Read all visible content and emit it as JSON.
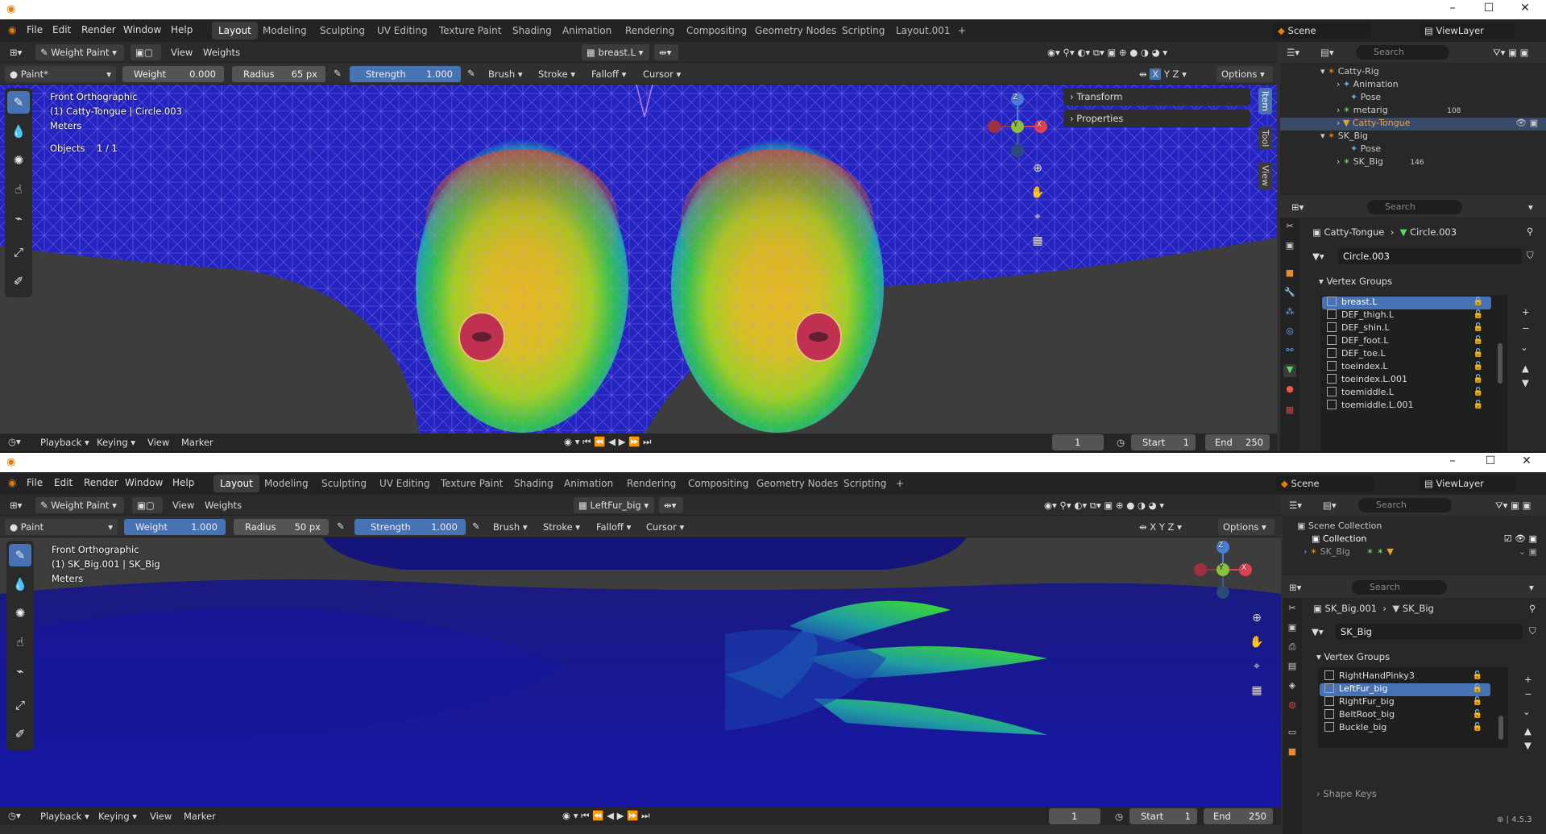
{
  "top": {
    "title_icon": "blender-logo",
    "menu": [
      "File",
      "Edit",
      "Render",
      "Window",
      "Help"
    ],
    "workspaces": [
      "Layout",
      "Modeling",
      "Sculpting",
      "UV Editing",
      "Texture Paint",
      "Shading",
      "Animation",
      "Rendering",
      "Compositing",
      "Geometry Nodes",
      "Scripting",
      "Layout.001"
    ],
    "active_workspace": "Layout",
    "add_tab": "+",
    "scene": "Scene",
    "view_layer": "ViewLayer",
    "header": {
      "mode": "Weight Paint",
      "view": "View",
      "weights": "Weights",
      "active_group": "breast.L",
      "brush_name": "Paint*",
      "weight_label": "Weight",
      "weight_value": "0.000",
      "radius_label": "Radius",
      "radius_value": "65 px",
      "strength_label": "Strength",
      "strength_value": "1.000",
      "brush": "Brush",
      "stroke": "Stroke",
      "falloff": "Falloff",
      "cursor": "Cursor",
      "options": "Options",
      "x": "X",
      "y": "Y",
      "z": "Z"
    },
    "overlay": {
      "view_name": "Front Orthographic",
      "object_info": "(1) Catty-Tongue | Circle.003",
      "units": "Meters",
      "objects_label": "Objects",
      "objects_value": "1 / 1"
    },
    "npanel": {
      "transform": "Transform",
      "properties": "Properties",
      "tabs": [
        "Item",
        "Tool",
        "View"
      ]
    },
    "gizmo": {
      "x": "X",
      "y": "Y",
      "z": "Z"
    },
    "timeline": {
      "playback": "Playback",
      "keying": "Keying",
      "view": "View",
      "marker": "Marker",
      "frame": "1",
      "start_label": "Start",
      "start": "1",
      "end_label": "End",
      "end": "250"
    },
    "outliner": {
      "search": "Search",
      "rows": [
        {
          "label": "Catty-Rig",
          "count": ""
        },
        {
          "label": "Animation",
          "count": ""
        },
        {
          "label": "Pose",
          "count": ""
        },
        {
          "label": "metarig",
          "count": "108"
        },
        {
          "label": "Catty-Tongue",
          "count": ""
        },
        {
          "label": "SK_Big",
          "count": ""
        },
        {
          "label": "Pose",
          "count": ""
        },
        {
          "label": "SK_Big",
          "count": "146"
        }
      ]
    },
    "props": {
      "search": "Search",
      "breadcrumb_obj": "Catty-Tongue",
      "breadcrumb_data": "Circle.003",
      "data_name": "Circle.003",
      "vg_title": "Vertex Groups",
      "groups": [
        "breast.L",
        "DEF_thigh.L",
        "DEF_shin.L",
        "DEF_foot.L",
        "DEF_toe.L",
        "toeindex.L",
        "toeindex.L.001",
        "toemiddle.L",
        "toemiddle.L.001"
      ],
      "selected": "breast.L"
    }
  },
  "bottom": {
    "menu": [
      "File",
      "Edit",
      "Render",
      "Window",
      "Help"
    ],
    "workspaces": [
      "Layout",
      "Modeling",
      "Sculpting",
      "UV Editing",
      "Texture Paint",
      "Shading",
      "Animation",
      "Rendering",
      "Compositing",
      "Geometry Nodes",
      "Scripting"
    ],
    "active_workspace": "Layout",
    "add_tab": "+",
    "scene": "Scene",
    "view_layer": "ViewLayer",
    "header": {
      "mode": "Weight Paint",
      "view": "View",
      "weights": "Weights",
      "active_group": "LeftFur_big",
      "brush_name": "Paint",
      "weight_label": "Weight",
      "weight_value": "1.000",
      "radius_label": "Radius",
      "radius_value": "50 px",
      "strength_label": "Strength",
      "strength_value": "1.000",
      "brush": "Brush",
      "stroke": "Stroke",
      "falloff": "Falloff",
      "cursor": "Cursor",
      "options": "Options",
      "x": "X",
      "y": "Y",
      "z": "Z"
    },
    "overlay": {
      "view_name": "Front Orthographic",
      "object_info": "(1) SK_Big.001 | SK_Big",
      "units": "Meters"
    },
    "gizmo": {
      "x": "X",
      "y": "Y",
      "z": "Z"
    },
    "timeline": {
      "playback": "Playback",
      "keying": "Keying",
      "view": "View",
      "marker": "Marker",
      "frame": "1",
      "start_label": "Start",
      "start": "1",
      "end_label": "End",
      "end": "250"
    },
    "outliner": {
      "search": "Search",
      "rows": [
        {
          "label": "Scene Collection"
        },
        {
          "label": "Collection"
        },
        {
          "label": "SK_Big"
        }
      ]
    },
    "props": {
      "search": "Search",
      "breadcrumb_obj": "SK_Big.001",
      "breadcrumb_data": "SK_Big",
      "data_name": "SK_Big",
      "vg_title": "Vertex Groups",
      "groups": [
        "RightHandPinky3",
        "LeftFur_big",
        "RightFur_big",
        "BeltRoot_big",
        "Buckle_big"
      ],
      "selected": "LeftFur_big",
      "next_section": "Shape Keys"
    },
    "version": "4.5.3"
  },
  "colors": {
    "accent": "#4772b3",
    "panel": "#282828",
    "header": "#232323",
    "mesh_blue": "#1a1ab8",
    "weight_red": "#e0402a",
    "weight_green": "#38d838"
  }
}
